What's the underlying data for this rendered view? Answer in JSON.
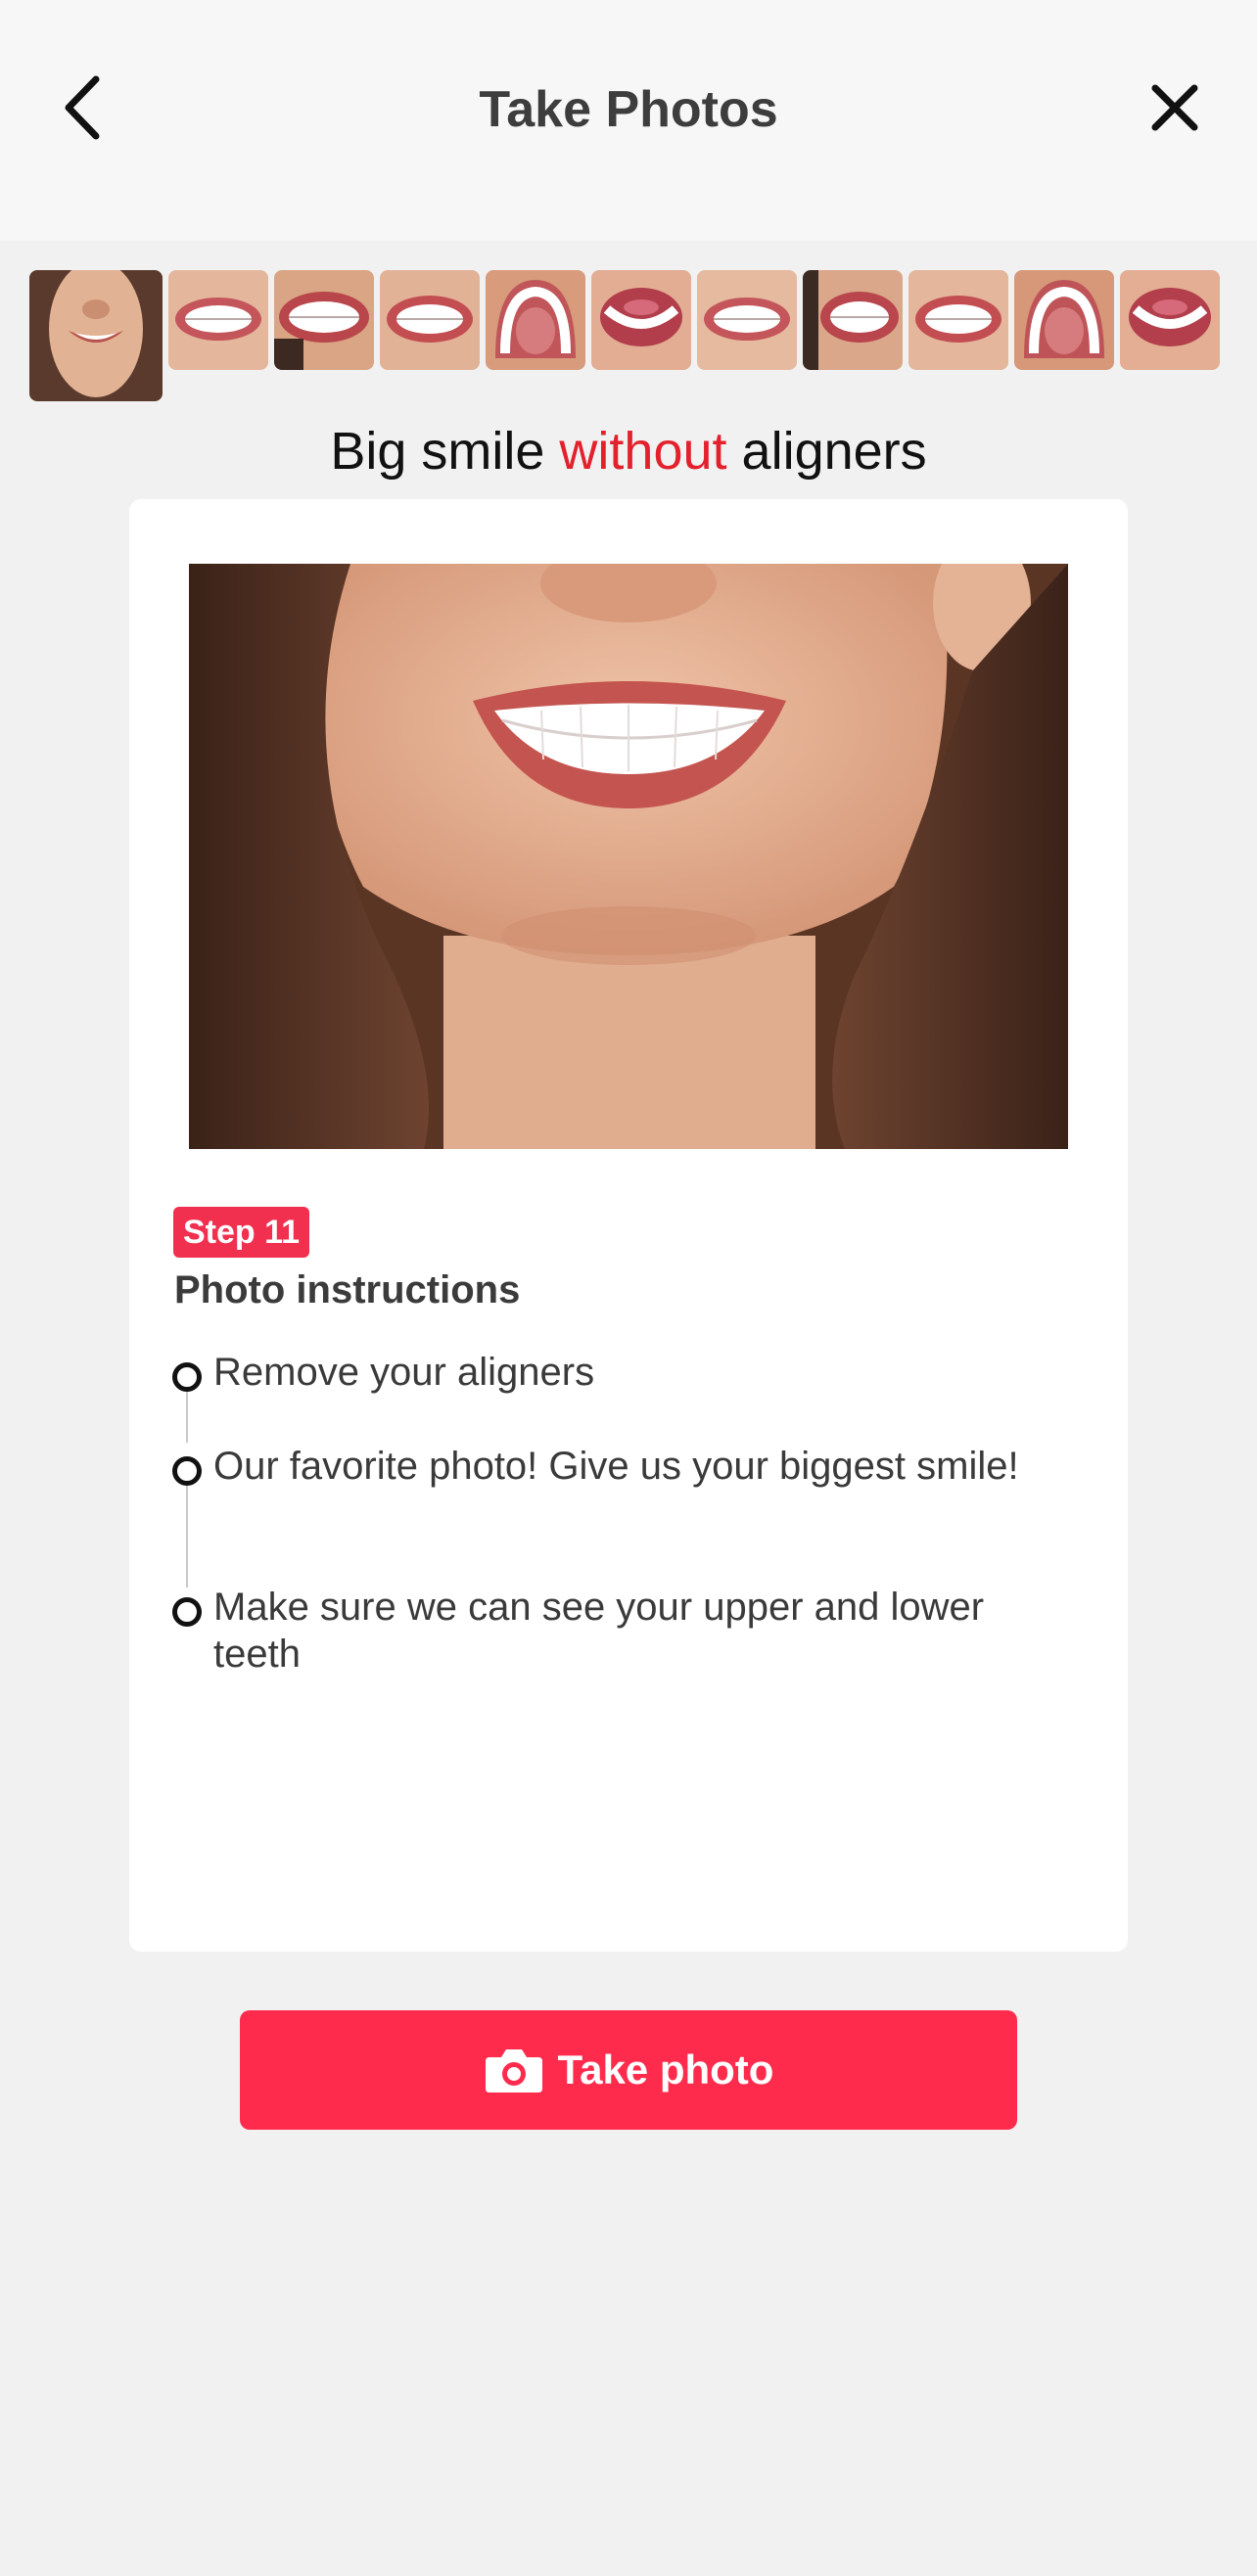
{
  "header": {
    "title": "Take Photos",
    "back_icon": "chevron-left-icon",
    "close_icon": "close-icon"
  },
  "thumbnails": {
    "count": 12,
    "active_index": 0,
    "kinds": [
      "face-smile",
      "teeth-front",
      "teeth-retract",
      "teeth-front",
      "upper-arch",
      "lower-teeth",
      "teeth-front",
      "teeth-side",
      "teeth-front",
      "upper-arch",
      "lower-teeth"
    ]
  },
  "step_heading": {
    "part1": "Big smile",
    "accent": "without",
    "part2": "aligners"
  },
  "card": {
    "badge": "Step 11",
    "instructions_title": "Photo instructions",
    "instructions": [
      "Remove your aligners",
      "Our favorite photo! Give us your biggest smile!",
      "Make sure we can see your upper and lower teeth"
    ]
  },
  "cta": {
    "label": "Take photo",
    "icon": "camera-icon"
  },
  "colors": {
    "accent_red": "#e3212d",
    "button_red": "#ff2b4d",
    "badge_red": "#f1304f"
  }
}
